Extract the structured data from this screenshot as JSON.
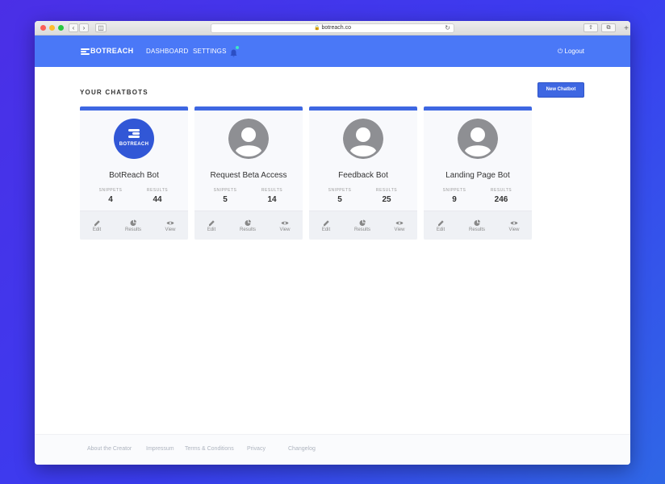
{
  "browser": {
    "url": "botreach.co"
  },
  "nav": {
    "brand": "BOTREACH",
    "links": [
      "DASHBOARD",
      "SETTINGS"
    ],
    "logout": "Logout"
  },
  "page": {
    "heading": "YOUR CHATBOTS",
    "new_button": "New Chatbot"
  },
  "bots": [
    {
      "name": "BotReach Bot",
      "avatar": "brand-logo",
      "avatar_text": "BOTREACH",
      "snippets_label": "SNIPPETS",
      "snippets": "4",
      "results_label": "RESULTS",
      "results": "44"
    },
    {
      "name": "Request Beta Access",
      "avatar": "default-user",
      "snippets_label": "SNIPPETS",
      "snippets": "5",
      "results_label": "RESULTS",
      "results": "14"
    },
    {
      "name": "Feedback Bot",
      "avatar": "default-user",
      "snippets_label": "SNIPPETS",
      "snippets": "5",
      "results_label": "RESULTS",
      "results": "25"
    },
    {
      "name": "Landing Page Bot",
      "avatar": "default-user",
      "snippets_label": "SNIPPETS",
      "snippets": "9",
      "results_label": "RESULTS",
      "results": "246"
    }
  ],
  "card_actions": [
    "Edit",
    "Results",
    "View"
  ],
  "footer": {
    "links": [
      "About the Creator",
      "Impressum",
      "Terms & Conditions",
      "Privacy",
      "Changelog"
    ]
  },
  "colors": {
    "nav_bg": "#4a78f7",
    "accent": "#3e67e2",
    "notification": "#3ee6c8"
  }
}
